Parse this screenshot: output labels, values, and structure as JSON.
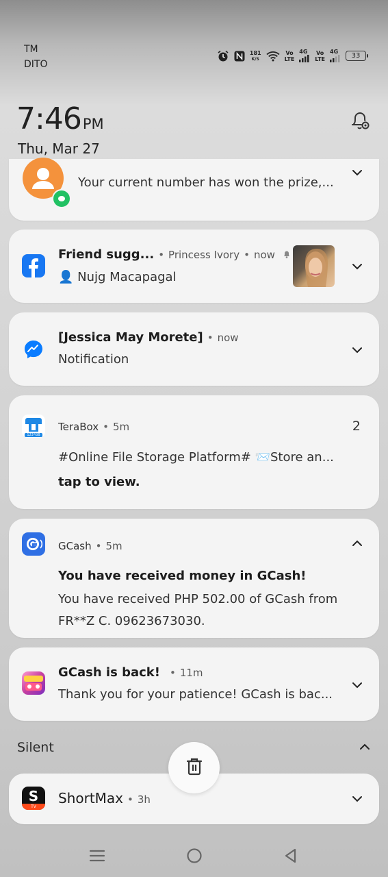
{
  "status_bar": {
    "carrier_1": "TM",
    "carrier_2": "DITO",
    "speed_value": "181",
    "speed_unit": "K/S",
    "volte_1": "Vo\nLTE",
    "network_1": "4G",
    "volte_2": "Vo\nLTE",
    "network_2": "4G",
    "battery": "33"
  },
  "clock": {
    "time": "7:46",
    "ampm": "PM",
    "date": "Thu, Mar 27"
  },
  "notifications": [
    {
      "id": "prize",
      "text": "Your current number has won the prize,..."
    },
    {
      "id": "facebook",
      "title": "Friend sugg...",
      "source": "Princess Ivory",
      "time": "now",
      "text": "👤 Nujg Macapagal"
    },
    {
      "id": "messenger",
      "title": "[Jessica May Morete]",
      "time": "now",
      "text": "Notification"
    },
    {
      "id": "terabox",
      "app": "TeraBox",
      "time": "5m",
      "count": "2",
      "text_1": "#Online File Storage Platform# 📨Store an...",
      "text_2": "tap to view.",
      "icon_label": "123*GB"
    },
    {
      "id": "gcash",
      "app": "GCash",
      "time": "5m",
      "title": "You have received money in GCash!",
      "text_1": "You have received PHP 502.00 of GCash from",
      "text_2": "FR**Z C. 09623673030."
    },
    {
      "id": "game",
      "title": "GCash is back!",
      "time": "11m",
      "text": "Thank you for your patience! GCash is bac..."
    }
  ],
  "silent": {
    "label": "Silent",
    "items": [
      {
        "id": "shortmax",
        "app": "ShortMax",
        "time": "3h",
        "icon_letter": "S",
        "icon_sub": "TV"
      }
    ]
  },
  "colors": {
    "facebook": "#1877f2",
    "messenger": "#0a7cff",
    "terabox": "#1e88e5",
    "gcash": "#2f6fe4",
    "orange_avatar": "#f4923c",
    "green_badge": "#21c163"
  }
}
